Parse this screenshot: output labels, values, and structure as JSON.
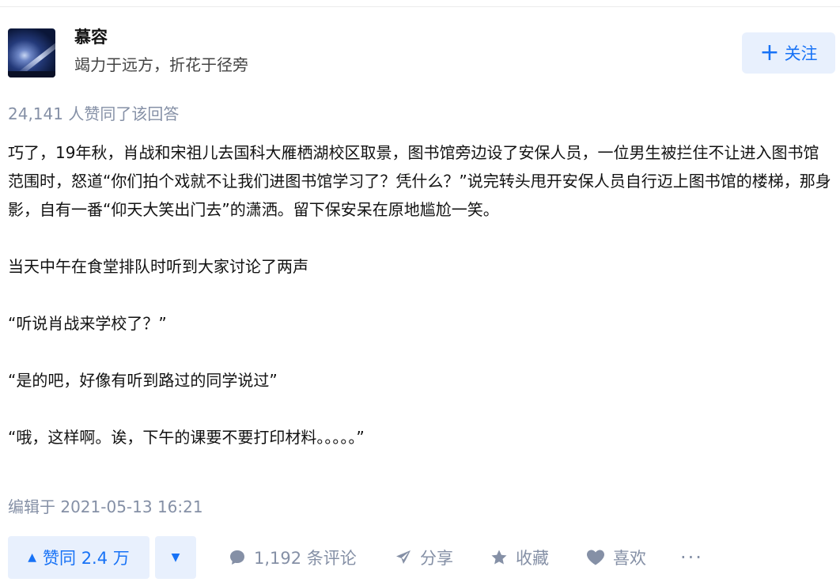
{
  "author": {
    "name": "慕容",
    "bio": "竭力于远方，折花于径旁",
    "follow_label": "关注"
  },
  "answer": {
    "votes_summary": "24,141 人赞同了该回答",
    "paragraphs": [
      "巧了，19年秋，肖战和宋祖儿去国科大雁栖湖校区取景，图书馆旁边设了安保人员，一位男生被拦住不让进入图书馆范围时，怒道“你们拍个戏就不让我们进图书馆学习了？凭什么？”说完转头甩开安保人员自行迈上图书馆的楼梯，那身影，自有一番“仰天大笑出门去”的潇洒。留下保安呆在原地尴尬一笑。",
      "当天中午在食堂排队时听到大家讨论了两声",
      "“听说肖战来学校了？”",
      "“是的吧，好像有听到路过的同学说过”",
      "“哦，这样啊。诶，下午的课要不要打印材料。。。。。”"
    ],
    "edit_time": "编辑于 2021-05-13 16:21"
  },
  "actions": {
    "vote_up_label": "赞同 2.4 万",
    "vote_down_label": "▼",
    "comment_label": "1,192 条评论",
    "share_label": "分享",
    "favorite_label": "收藏",
    "like_label": "喜欢",
    "more_label": "···"
  },
  "colors": {
    "accent": "#1772f6",
    "accent_bg": "#e8f0fd",
    "muted": "#8590a6"
  },
  "icons": [
    "avatar-image",
    "plus-icon",
    "triangle-up-icon",
    "triangle-down-icon",
    "comment-icon",
    "share-icon",
    "star-icon",
    "heart-icon",
    "more-icon"
  ]
}
